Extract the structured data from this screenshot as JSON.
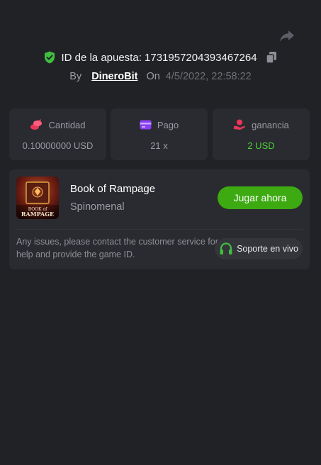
{
  "header": {
    "bet_id_label": "ID de la apuesta: 1731957204393467264",
    "by_label": "By",
    "username": "DineroBit",
    "on_label": "On",
    "date": "4/5/2022, 22:58:22"
  },
  "stats": [
    {
      "label": "Cantidad",
      "value": "0.10000000 USD",
      "icon": "coins-icon",
      "color": "#e8375a"
    },
    {
      "label": "Pago",
      "value": "21 x",
      "icon": "card-icon",
      "color": "#8a3df2"
    },
    {
      "label": "ganancia",
      "value": "2 USD",
      "icon": "hand-coin-icon",
      "color": "#e8375a"
    }
  ],
  "game": {
    "title": "Book of Rampage",
    "provider": "Spinomenal",
    "thumb_text_top": "BOOK of",
    "thumb_text_bottom": "RAMPAGE",
    "play_label": "Jugar ahora"
  },
  "help": {
    "message": "Any issues, please contact the customer service for help and provide the game ID.",
    "support_label": "Soporte en vivo"
  },
  "colors": {
    "background": "#212225",
    "card": "#2a2b30",
    "accent_green": "#3daa12",
    "win_green": "#4cd137"
  }
}
